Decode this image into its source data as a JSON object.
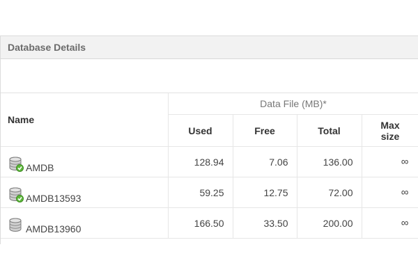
{
  "panel": {
    "title": "Database Details"
  },
  "table": {
    "name_header": "Name",
    "group_header": "Data File (MB)*",
    "sub_headers": {
      "used": "Used",
      "free": "Free",
      "total": "Total",
      "max_line1": "Max",
      "max_line2": "size"
    },
    "rows": [
      {
        "name": "AMDB",
        "used": "128.94",
        "free": "7.06",
        "total": "136.00",
        "max": "∞",
        "icon": "database-ok-icon"
      },
      {
        "name": "AMDB13593",
        "used": "59.25",
        "free": "12.75",
        "total": "72.00",
        "max": "∞",
        "icon": "database-ok-icon"
      },
      {
        "name": "AMDB13960",
        "used": "166.50",
        "free": "33.50",
        "total": "200.00",
        "max": "∞",
        "icon": "database-icon"
      }
    ]
  },
  "colors": {
    "header_bg": "#f2f2f2",
    "border": "#e6e6e6",
    "ok_badge": "#5cb83a"
  }
}
